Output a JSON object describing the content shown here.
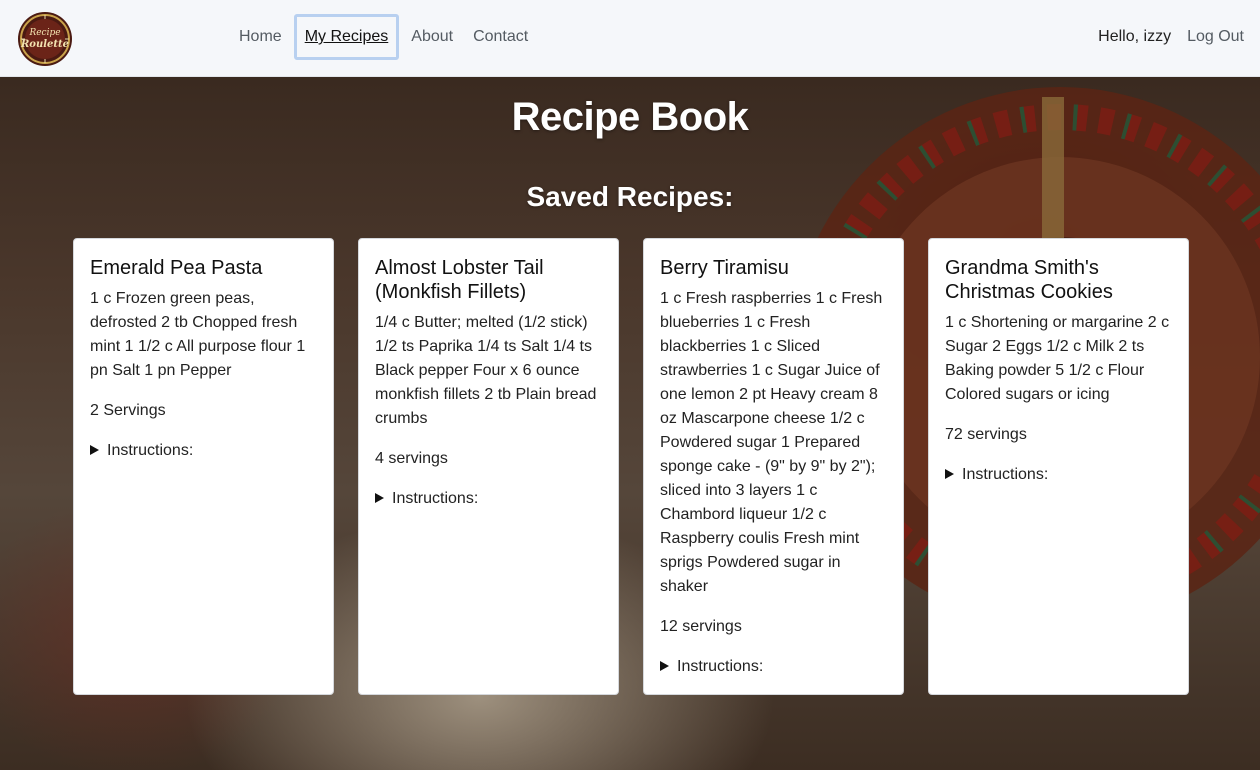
{
  "nav": {
    "links": [
      "Home",
      "My Recipes",
      "About",
      "Contact"
    ],
    "greeting": "Hello, izzy",
    "logout": "Log Out",
    "logo_text_top": "Recipe",
    "logo_text_bottom": "Roulette"
  },
  "page": {
    "title": "Recipe Book",
    "subtitle": "Saved Recipes:"
  },
  "recipes": [
    {
      "title": "Emerald Pea Pasta",
      "ingredients": "1 c Frozen green peas, defrosted 2 tb Chopped fresh mint 1 1/2 c All purpose flour 1 pn Salt 1 pn Pepper",
      "servings": "2 Servings",
      "instructions_label": "Instructions:"
    },
    {
      "title": "Almost Lobster Tail (Monkfish Fillets)",
      "ingredients": "1/4 c Butter; melted (1/2 stick) 1/2 ts Paprika 1/4 ts Salt 1/4 ts Black pepper Four x 6 ounce monkfish fillets 2 tb Plain bread crumbs",
      "servings": "4 servings",
      "instructions_label": "Instructions:"
    },
    {
      "title": "Berry Tiramisu",
      "ingredients": "1 c Fresh raspberries 1 c Fresh blueberries 1 c Fresh blackberries 1 c Sliced strawberries 1 c Sugar Juice of one lemon 2 pt Heavy cream 8 oz Mascarpone cheese 1/2 c Powdered sugar 1 Prepared sponge cake - (9\" by 9\" by 2\"); sliced into 3 layers 1 c Chambord liqueur 1/2 c Raspberry coulis Fresh mint sprigs Powdered sugar in shaker",
      "servings": "12 servings",
      "instructions_label": "Instructions:"
    },
    {
      "title": "Grandma Smith's Christmas Cookies",
      "ingredients": "1 c Shortening or margarine 2 c Sugar 2 Eggs 1/2 c Milk 2 ts Baking powder 5 1/2 c Flour Colored sugars or icing",
      "servings": "72 servings",
      "instructions_label": "Instructions:"
    }
  ],
  "colors": {
    "navbar_bg": "#f5f7fa",
    "active_outline": "#b8d0f0",
    "card_bg": "#ffffff"
  },
  "icons": {
    "logo": "recipe-roulette-logo",
    "disclosure": "disclosure-triangle-icon"
  }
}
